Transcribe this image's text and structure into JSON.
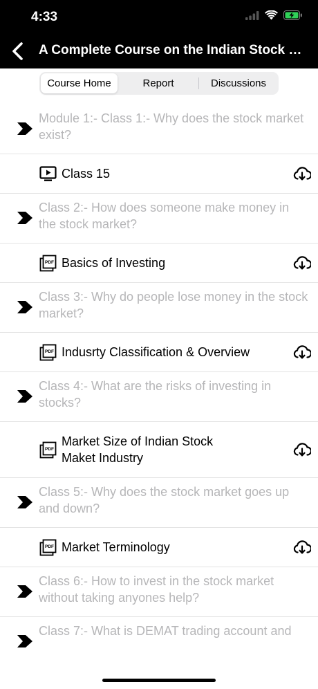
{
  "status": {
    "time": "4:33"
  },
  "header": {
    "title": "A Complete Course on the Indian Stock M..."
  },
  "tabs": [
    {
      "label": "Course Home"
    },
    {
      "label": "Report"
    },
    {
      "label": "Discussions"
    }
  ],
  "rows": [
    {
      "type": "module",
      "text": "Module 1:- Class 1:- Why does the stock market exist?"
    },
    {
      "type": "item",
      "icon": "video-icon",
      "text": "Class 15"
    },
    {
      "type": "module",
      "text": "Class 2:- How does someone make money in the stock market?"
    },
    {
      "type": "item",
      "icon": "pdf-icon",
      "text": "Basics of Investing"
    },
    {
      "type": "module",
      "text": "Class 3:- Why do people lose money in the stock market?"
    },
    {
      "type": "item",
      "icon": "pdf-icon",
      "text": "Indusrty Classification & Overview"
    },
    {
      "type": "module",
      "text": "Class 4:- What are the risks of investing in stocks?"
    },
    {
      "type": "item",
      "icon": "pdf-icon",
      "text": "Market Size of Indian Stock Maket Industry"
    },
    {
      "type": "module",
      "text": "Class 5:- Why does the stock market goes up and down?"
    },
    {
      "type": "item",
      "icon": "pdf-icon",
      "text": "Market Terminology"
    },
    {
      "type": "module",
      "text": "Class 6:- How to invest in the stock market without taking anyones help?"
    },
    {
      "type": "module",
      "text": "Class 7:- What is DEMAT trading account and"
    }
  ]
}
